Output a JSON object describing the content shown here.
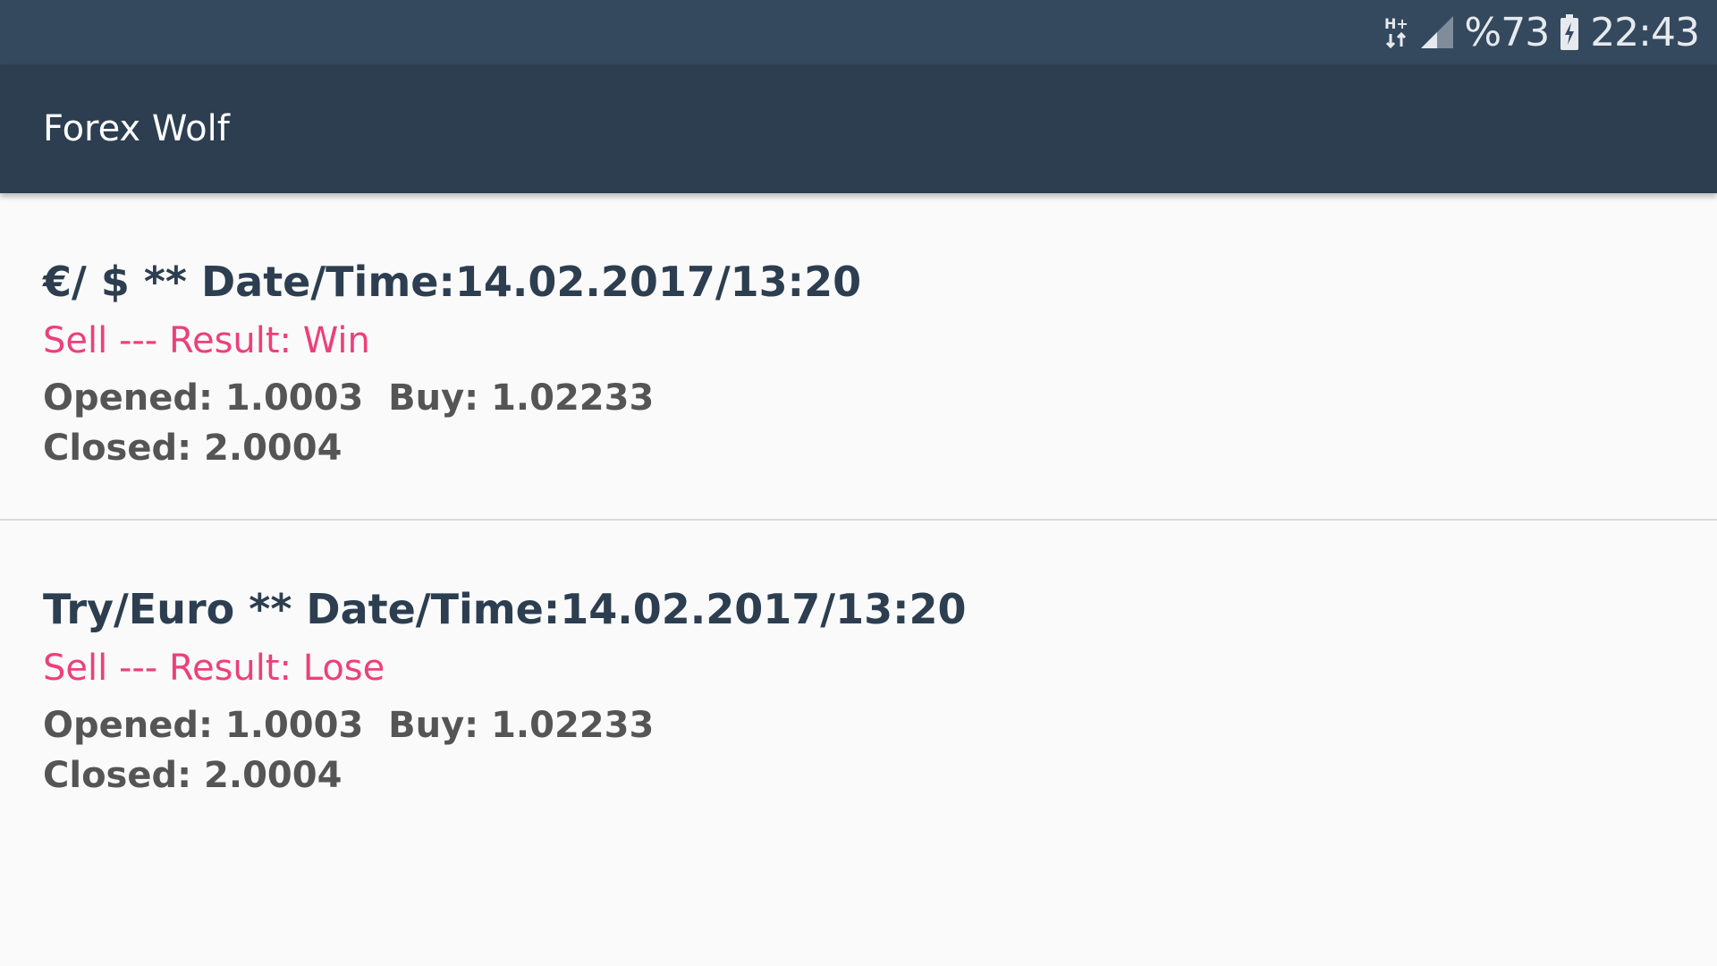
{
  "status_bar": {
    "network_type": "H+",
    "battery_percent": "%73",
    "time": "22:43",
    "icons": [
      "hplus-data-icon",
      "signal-strength-icon",
      "battery-charging-icon"
    ]
  },
  "app_bar": {
    "title": "Forex Wolf"
  },
  "trades": [
    {
      "header": "€/ $ ** Date/Time:14.02.2017/13:20",
      "result": "Sell --- Result: Win",
      "opened_buy": "Opened: 1.0003  Buy: 1.02233",
      "closed": "Closed: 2.0004"
    },
    {
      "header": "Try/Euro ** Date/Time:14.02.2017/13:20",
      "result": "Sell --- Result: Lose",
      "opened_buy": "Opened: 1.0003  Buy: 1.02233",
      "closed": "Closed: 2.0004"
    }
  ],
  "colors": {
    "status_bar": "#34495e",
    "app_bar": "#2c3e50",
    "title_text": "#2c3e50",
    "accent_pink": "#ec407a",
    "detail_text": "#555555",
    "background": "#fafafa"
  }
}
